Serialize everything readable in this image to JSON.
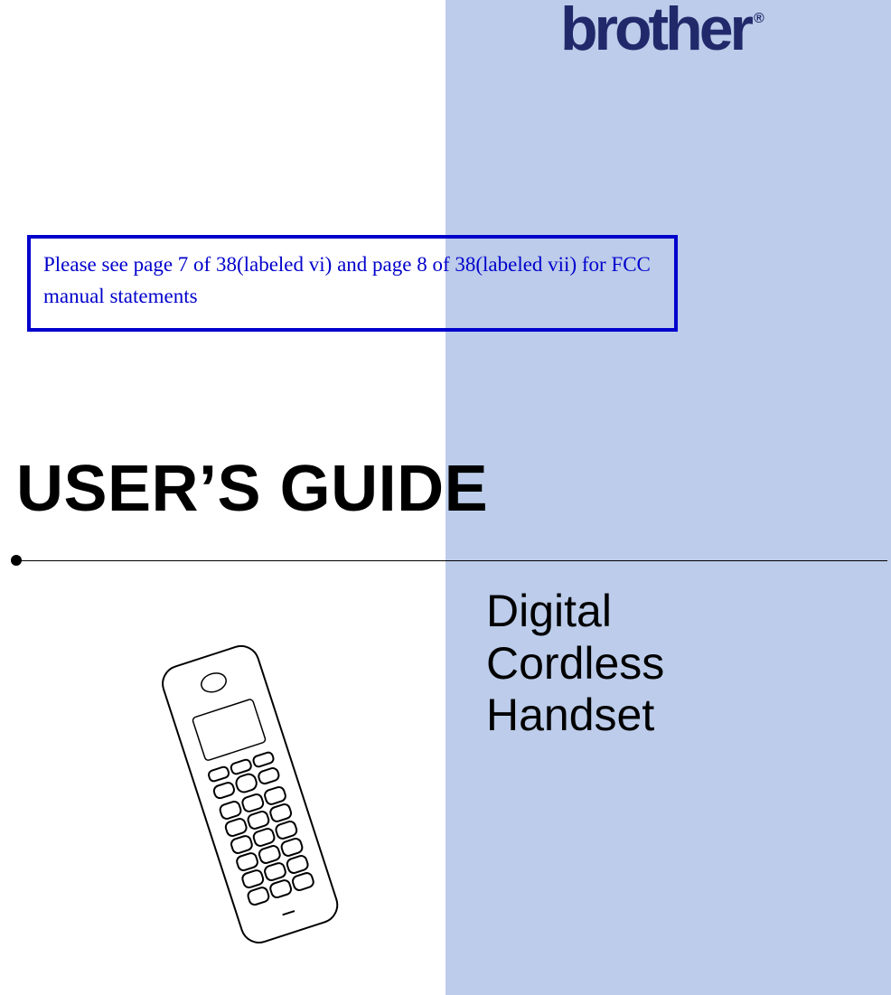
{
  "brand": {
    "name": "brother",
    "registered": "®"
  },
  "notice": "Please see page 7 of 38(labeled vi) and page 8 of 38(labeled vii) for FCC manual statements",
  "title": "USER’S GUIDE",
  "subtitle_lines": {
    "l1": "Digital",
    "l2": "Cordless",
    "l3": "Handset"
  }
}
